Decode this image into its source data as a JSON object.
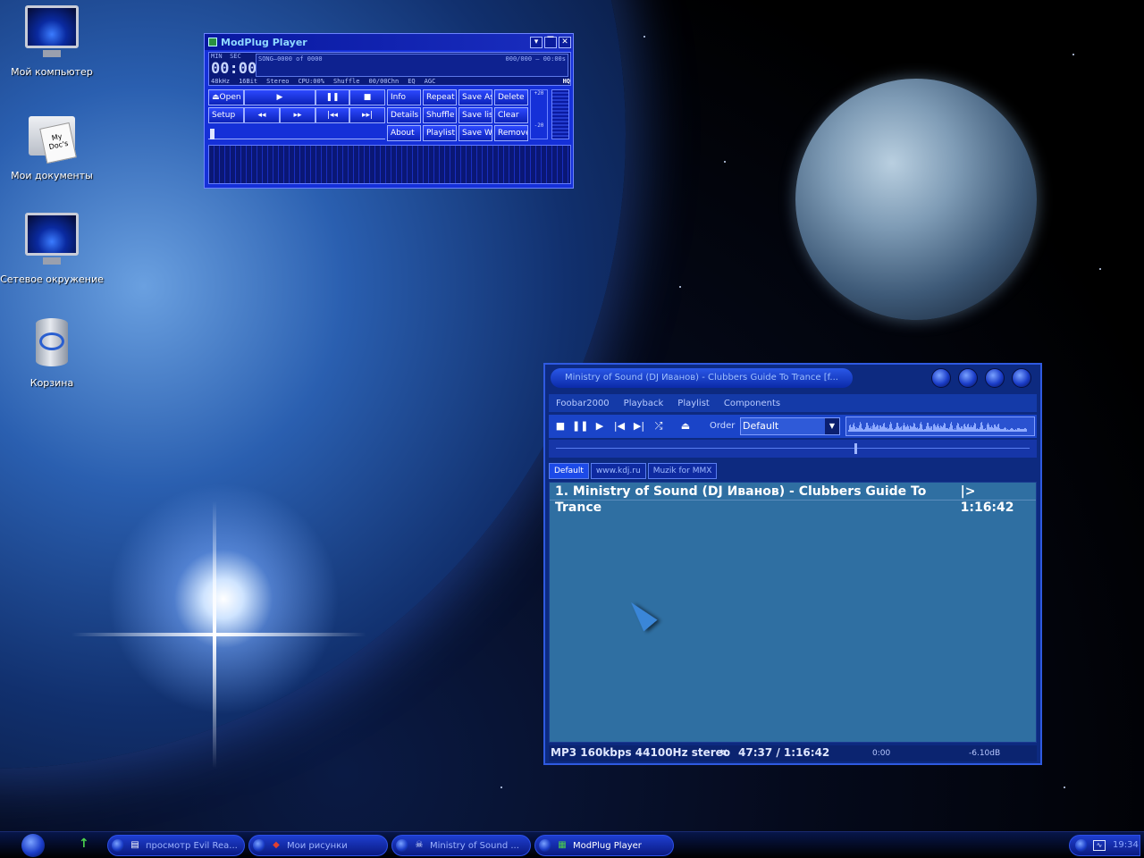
{
  "desktop": {
    "icons": [
      {
        "label": "Мой компьютер",
        "icon": "my-computer-icon"
      },
      {
        "label": "Мои документы",
        "icon": "my-documents-icon",
        "paper_text": "My Doc's"
      },
      {
        "label": "Сетевое окружение",
        "icon": "network-places-icon"
      },
      {
        "label": "Корзина",
        "icon": "recycle-bin-icon"
      }
    ]
  },
  "modplug": {
    "title": "ModPlug Player",
    "time_label_min": "MIN",
    "time_label_sec": "SEC",
    "time": "00:00",
    "song_label": "SONG",
    "song_pos": "0000 of 0000",
    "song_counter": "000/000",
    "song_seconds": "00:00s",
    "info": [
      "48kHz",
      "16Bit",
      "Stereo",
      "CPU:00%",
      "Shuffle",
      "00/00Chn",
      "EQ",
      "AGC"
    ],
    "quality": "HQ",
    "buttons": {
      "open": "Open",
      "setup": "Setup",
      "info": "Info",
      "repeat": "Repeat",
      "save_as": "Save As",
      "delete": "Delete",
      "details": "Details",
      "shuffle": "Shuffle",
      "save_list": "Save list",
      "clear": "Clear",
      "about": "About",
      "playlist": "Playlist",
      "save_wav": "Save Wav",
      "remove": "Remove"
    },
    "transport_glyphs": {
      "play": "▶",
      "pause": "❚❚",
      "stop": "■",
      "rew": "◂◂",
      "ffw": "▸▸",
      "prev": "|◂◂",
      "next": "▸▸|"
    },
    "volume_top": "+20",
    "volume_bottom": "-20"
  },
  "foobar": {
    "title": "Ministry of Sound  (DJ Иванов)  - Clubbers Guide To Trance  [f...",
    "menu": [
      "Foobar2000",
      "Playback",
      "Playlist",
      "Components"
    ],
    "toolbar": {
      "stop": "■",
      "pause": "❚❚",
      "play": "▶",
      "prev": "|◀",
      "next": "▶|",
      "random": "⤮",
      "open": "⏏"
    },
    "order_label": "Order",
    "order_value": "Default",
    "seek_position": 0.63,
    "tabs": [
      "Default",
      "www.kdj.ru",
      "Muzik for MMX"
    ],
    "playlist": [
      {
        "title": "1. Ministry of Sound (DJ Иванов) - Clubbers Guide To Trance",
        "duration": "|> 1:16:42"
      }
    ],
    "status": {
      "format": "MP3 160kbps 44100Hz stereo",
      "separator": "¤",
      "progress": "47:37 / 1:16:42",
      "selection_time": "0:00",
      "gain": "-6.10dB"
    }
  },
  "taskbar": {
    "tasks": [
      {
        "label": "просмотр Evil Rea...",
        "icon": "viewer-icon"
      },
      {
        "label": "Мои рисунки",
        "icon": "pictures-folder-icon"
      },
      {
        "label": "Ministry of Sound ...",
        "icon": "foobar-icon"
      },
      {
        "label": "ModPlug Player",
        "icon": "modplug-icon"
      }
    ],
    "clock": "19:34"
  }
}
